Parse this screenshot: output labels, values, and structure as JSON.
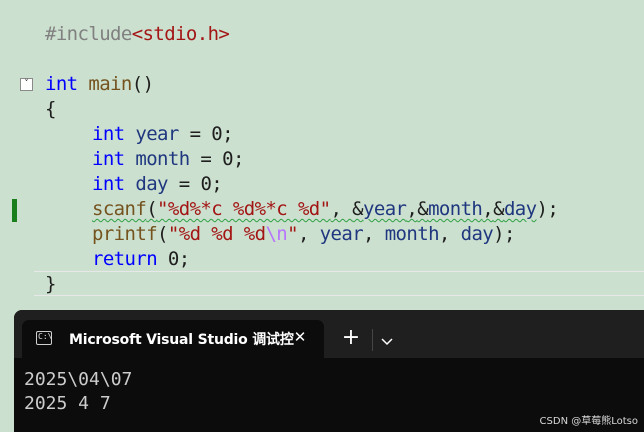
{
  "editor": {
    "include": {
      "directive": "#include",
      "header": "<stdio.h>"
    },
    "main_signature": {
      "return_type": "int",
      "name": "main",
      "parens": "()"
    },
    "open_brace": "{",
    "decl_year": {
      "type": "int",
      "name": "year",
      "op": "=",
      "value": "0",
      "semi": ";"
    },
    "decl_month": {
      "type": "int",
      "name": "month",
      "op": "=",
      "value": "0",
      "semi": ";"
    },
    "decl_day": {
      "type": "int",
      "name": "day",
      "op": "=",
      "value": "0",
      "semi": ";"
    },
    "scanf_line": {
      "func": "scanf",
      "open": "(",
      "format": "\"%d%*c %d%*c %d\"",
      "sep1": ", ",
      "amp1": "&",
      "arg1": "year",
      "sep2": ",",
      "amp2": "&",
      "arg2": "month",
      "sep3": ",",
      "amp3": "&",
      "arg3": "day",
      "close": ");"
    },
    "printf_line": {
      "func": "printf",
      "open": "(",
      "fmt_text": "\"%d %d %d",
      "escape": "\\n",
      "fmt_end": "\"",
      "sep1": ", ",
      "arg1": "year",
      "sep2": ", ",
      "arg2": "month",
      "sep3": ", ",
      "arg3": "day",
      "close": ");"
    },
    "return_line": {
      "keyword": "return",
      "value": "0",
      "semi": ";"
    },
    "close_brace": "}",
    "fold_glyph": "˅",
    "colors": {
      "background": "#cce0cf",
      "keyword": "#0000ff",
      "type": "#2b91af",
      "function": "#74531f",
      "variable": "#1f377f",
      "string": "#a31515",
      "preprocessor": "#808080",
      "escape": "#b776fb",
      "change_marker": "#1a7f1a",
      "squiggle": "#2ea043"
    }
  },
  "terminal": {
    "tab_title": "Microsoft Visual Studio 调试控",
    "tab_icon_glyph": "C:\\",
    "close_glyph": "✕",
    "new_tab_glyph": "+",
    "dropdown_icon": "chevron-down-icon",
    "output_lines": [
      "2025\\04\\07",
      "2025 4 7"
    ],
    "colors": {
      "background": "#0c0c0c",
      "tab_strip": "#1f1f1f",
      "text": "#cccccc"
    }
  },
  "watermark": "CSDN @草莓熊Lotso"
}
